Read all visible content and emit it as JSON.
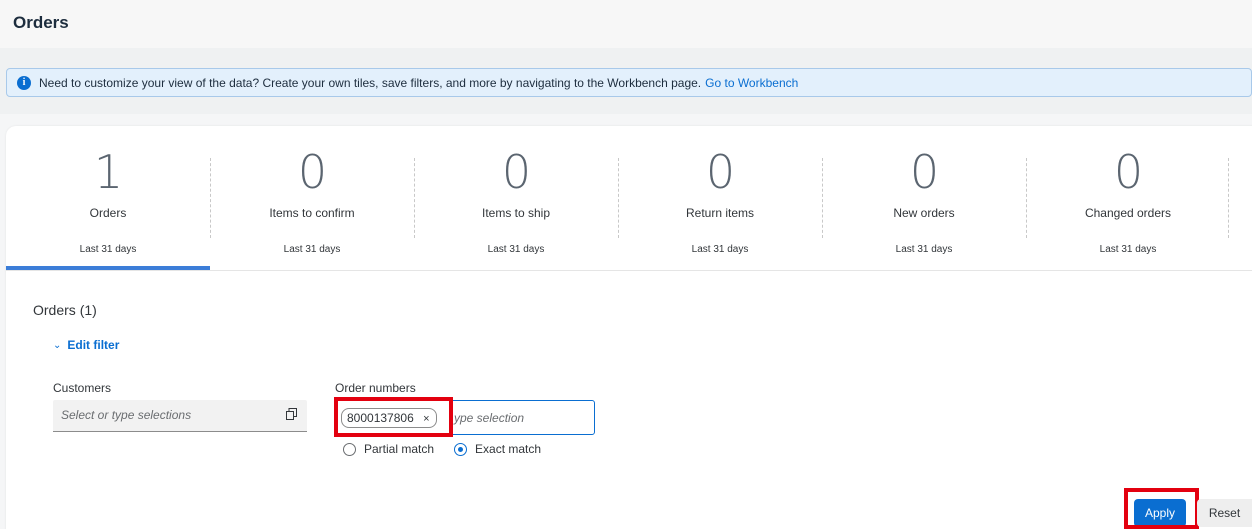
{
  "page": {
    "title": "Orders"
  },
  "info_banner": {
    "text": "Need to customize your view of the data? Create your own tiles, save filters, and more by navigating to the Workbench page.",
    "link": "Go to Workbench",
    "icon": "info-icon"
  },
  "tiles": [
    {
      "value": "1",
      "label": "Orders",
      "period": "Last 31 days",
      "selected": true
    },
    {
      "value": "0",
      "label": "Items to confirm",
      "period": "Last 31 days"
    },
    {
      "value": "0",
      "label": "Items to ship",
      "period": "Last 31 days"
    },
    {
      "value": "0",
      "label": "Return items",
      "period": "Last 31 days"
    },
    {
      "value": "0",
      "label": "New orders",
      "period": "Last 31 days"
    },
    {
      "value": "0",
      "label": "Changed orders",
      "period": "Last 31 days"
    }
  ],
  "results": {
    "heading": "Orders",
    "count": "(1)"
  },
  "filter": {
    "toggle_label": "Edit filter",
    "customers": {
      "label": "Customers",
      "placeholder": "Select or type selections",
      "icon": "value-help-icon"
    },
    "order_numbers": {
      "label": "Order numbers",
      "token": "8000137806",
      "token_close": "×",
      "placeholder": "ype selection",
      "match_options": [
        {
          "label": "Partial match",
          "checked": false
        },
        {
          "label": "Exact match",
          "checked": true
        }
      ]
    }
  },
  "actions": {
    "apply": "Apply",
    "reset": "Reset"
  },
  "colors": {
    "accent": "#0a6ed1",
    "highlight": "#e3000f",
    "banner_bg": "#e3f0fc"
  }
}
